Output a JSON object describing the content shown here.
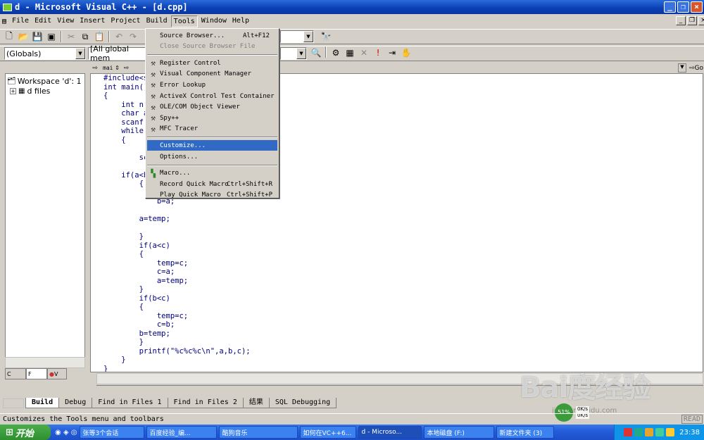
{
  "window": {
    "title": "d - Microsoft Visual C++ - [d.cpp]",
    "min": "_",
    "max": "❐",
    "close": "×"
  },
  "menubar": [
    "File",
    "Edit",
    "View",
    "Insert",
    "Project",
    "Build",
    "Tools",
    "Window",
    "Help"
  ],
  "mdi_buttons": {
    "min": "_",
    "restore": "❐",
    "close": "×"
  },
  "toolbar2": {
    "globals": "(Globals)",
    "members": "[All global mem"
  },
  "editor_nav": {
    "fn": "mai",
    "go": "Go"
  },
  "workspace": {
    "root": "Workspace 'd': 1",
    "child": "d files",
    "tabs": [
      "C",
      "F",
      "V"
    ]
  },
  "code_lines": [
    "#include<s",
    "int main()",
    "{",
    "    int n;",
    "    char a",
    "    scanf(",
    "    while(",
    "    {",
    "",
    "        sc",
    "",
    "    if(a<b",
    "        {",
    "",
    "            b=a;",
    "",
    "        a=temp;",
    "",
    "        }",
    "        if(a<c)",
    "        {",
    "            temp=c;",
    "            c=a;",
    "            a=temp;",
    "        }",
    "        if(b<c)",
    "        {",
    "            temp=c;",
    "            c=b;",
    "        b=temp;",
    "        }",
    "        printf(\"%c%c%c\\n\",a,b,c);",
    "    }",
    "}"
  ],
  "tools_menu": {
    "items": [
      {
        "label": "Source Browser...",
        "shortcut": "Alt+F12",
        "disabled": false
      },
      {
        "label": "Close Source Browser File",
        "shortcut": "",
        "disabled": true
      },
      {
        "sep": true
      },
      {
        "label": "Register Control",
        "icon": "hammer-icon"
      },
      {
        "label": "Visual Component Manager",
        "icon": "hammer-icon"
      },
      {
        "label": "Error Lookup",
        "icon": "hammer-icon"
      },
      {
        "label": "ActiveX Control Test Container",
        "icon": "hammer-icon"
      },
      {
        "label": "OLE/COM Object Viewer",
        "icon": "hammer-icon"
      },
      {
        "label": "Spy++",
        "icon": "hammer-icon"
      },
      {
        "label": "MFC Tracer",
        "icon": "hammer-icon"
      },
      {
        "sep": true
      },
      {
        "label": "Customize...",
        "highlight": true
      },
      {
        "label": "Options..."
      },
      {
        "sep": true
      },
      {
        "label": "Macro...",
        "icon": "macro-icon"
      },
      {
        "label": "Record Quick Macro",
        "shortcut": "Ctrl+Shift+R"
      },
      {
        "label": "Play Quick Macro",
        "shortcut": "Ctrl+Shift+P"
      }
    ]
  },
  "output_tabs": [
    "Build",
    "Debug",
    "Find in Files 1",
    "Find in Files 2",
    "结果",
    "SQL Debugging"
  ],
  "status": {
    "text": "Customizes the Tools menu and toolbars",
    "mode": "READ"
  },
  "watermark": {
    "brand": "Bai度经验",
    "sub": "jingyan.baidu.com"
  },
  "speed": {
    "percent": "51%",
    "up": "0K/s",
    "down": "0K/s"
  },
  "taskbar": {
    "start": "开始",
    "buttons": [
      "张等3个会话",
      "百度经验_编...",
      "酷狗音乐",
      "如何在VC++6...",
      "d - Microso...",
      "本地磁盘 (F:)",
      "新建文件夹 (3)"
    ],
    "clock": "23:38"
  }
}
